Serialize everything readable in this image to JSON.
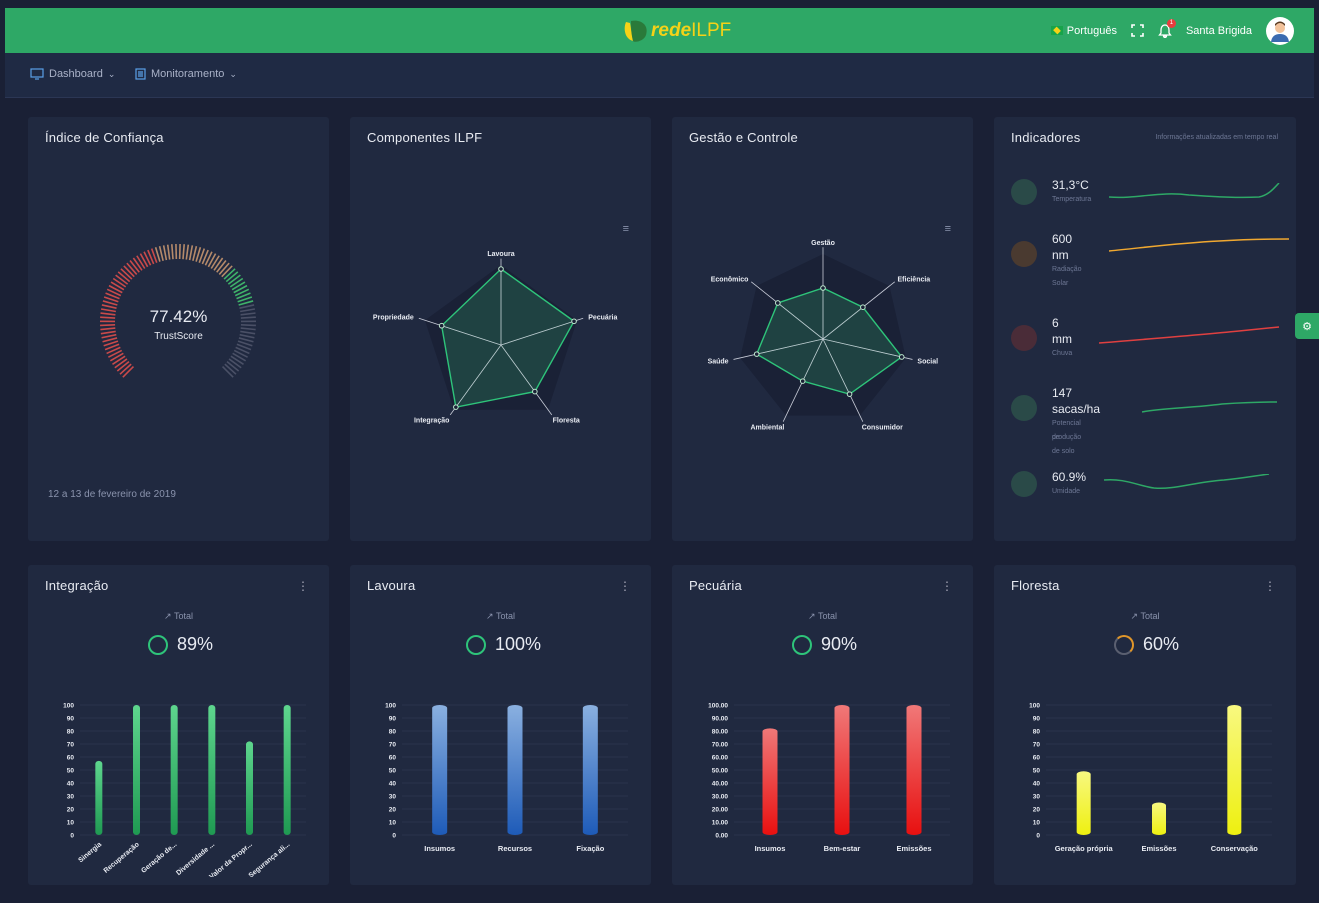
{
  "header": {
    "logo_text_part1": "rede",
    "logo_text_part2": "ILPF",
    "language": "Português",
    "user_name": "Santa Brigida",
    "notification_count": "1"
  },
  "nav": {
    "items": [
      {
        "label": "Dashboard",
        "icon": "monitor-icon"
      },
      {
        "label": "Monitoramento",
        "icon": "document-icon"
      }
    ]
  },
  "trust": {
    "title": "Índice de Confiança",
    "value": "77.42%",
    "label": "TrustScore",
    "fraction": 0.7742,
    "date": "12 a 13 de fevereiro de 2019"
  },
  "componentes": {
    "title": "Componentes ILPF",
    "axes": [
      "Lavoura",
      "Pecuária",
      "Floresta",
      "Integração",
      "Propriedade"
    ],
    "values": [
      0.95,
      0.96,
      0.72,
      0.96,
      0.78
    ]
  },
  "gestao": {
    "title": "Gestão e Controle",
    "axes": [
      "Gestão",
      "Eficiência",
      "Social",
      "Consumidor",
      "Ambiental",
      "Saúde",
      "Econômico"
    ],
    "values": [
      0.6,
      0.6,
      0.95,
      0.72,
      0.55,
      0.8,
      0.68
    ]
  },
  "indicadores": {
    "title": "Indicadores",
    "subtitle": "Informações atualizadas em tempo real",
    "items": [
      {
        "value_lines": [
          "31,3°C"
        ],
        "label_lines": [
          "Temperatura"
        ],
        "color": "#2ea866",
        "circle": "#2a4a48"
      },
      {
        "value_lines": [
          "600",
          "nm"
        ],
        "label_lines": [
          "Radiação",
          "Solar"
        ],
        "color": "#f0a830",
        "circle": "#4a3a30"
      },
      {
        "value_lines": [
          "6",
          "mm"
        ],
        "label_lines": [
          "Chuva"
        ],
        "color": "#e04040",
        "circle": "#4a2c38"
      },
      {
        "value_lines": [
          "147",
          "sacas/ha"
        ],
        "label_lines": [
          "Potencial de",
          "produção de solo"
        ],
        "color": "#2ea866",
        "circle": "#2a4a48"
      },
      {
        "value_lines": [
          "60.9%"
        ],
        "label_lines": [
          "Umidade"
        ],
        "color": "#2ea866",
        "circle": "#2a4a48"
      }
    ]
  },
  "chart_data": [
    {
      "type": "bar",
      "title": "Integração",
      "total_label": "Total",
      "total": "89%",
      "categories": [
        "Sinergia",
        "Recuperação",
        "Geração de...",
        "Diversidade ...",
        "Valor da Propr...",
        "Segurança ali..."
      ],
      "values": [
        57,
        100,
        100,
        100,
        72,
        100
      ],
      "ylim": [
        0,
        100
      ],
      "yticks": [
        "0",
        "10",
        "20",
        "30",
        "40",
        "50",
        "60",
        "70",
        "80",
        "90",
        "100"
      ],
      "color_top": "#5ed68e",
      "color_bottom": "#1f9a52",
      "ring_color": "#2ec47a",
      "rotate_labels": true
    },
    {
      "type": "bar",
      "title": "Lavoura",
      "total_label": "Total",
      "total": "100%",
      "categories": [
        "Insumos",
        "Recursos",
        "Fixação"
      ],
      "values": [
        100,
        100,
        100
      ],
      "ylim": [
        0,
        100
      ],
      "yticks": [
        "0",
        "10",
        "20",
        "30",
        "40",
        "50",
        "60",
        "70",
        "80",
        "90",
        "100"
      ],
      "color_top": "#8ab0e0",
      "color_bottom": "#1e5bb8",
      "ring_color": "#2ec47a",
      "rotate_labels": false
    },
    {
      "type": "bar",
      "title": "Pecuária",
      "total_label": "Total",
      "total": "90%",
      "categories": [
        "Insumos",
        "Bem-estar",
        "Emissões"
      ],
      "values": [
        82,
        100,
        100
      ],
      "ylim": [
        0,
        100
      ],
      "yticks": [
        "0.00",
        "10.00",
        "20.00",
        "30.00",
        "40.00",
        "50.00",
        "60.00",
        "70.00",
        "80.00",
        "90.00",
        "100.00"
      ],
      "color_top": "#f07878",
      "color_bottom": "#e81010",
      "ring_color": "#2ec47a",
      "rotate_labels": false
    },
    {
      "type": "bar",
      "title": "Floresta",
      "total_label": "Total",
      "total": "60%",
      "categories": [
        "Geração própria",
        "Emissões",
        "Conservação"
      ],
      "values": [
        49,
        25,
        100
      ],
      "ylim": [
        0,
        100
      ],
      "yticks": [
        "0",
        "10",
        "20",
        "30",
        "40",
        "50",
        "60",
        "70",
        "80",
        "90",
        "100"
      ],
      "color_top": "#f8f880",
      "color_bottom": "#eef010",
      "ring_color": "#e0962a",
      "rotate_labels": false
    }
  ]
}
